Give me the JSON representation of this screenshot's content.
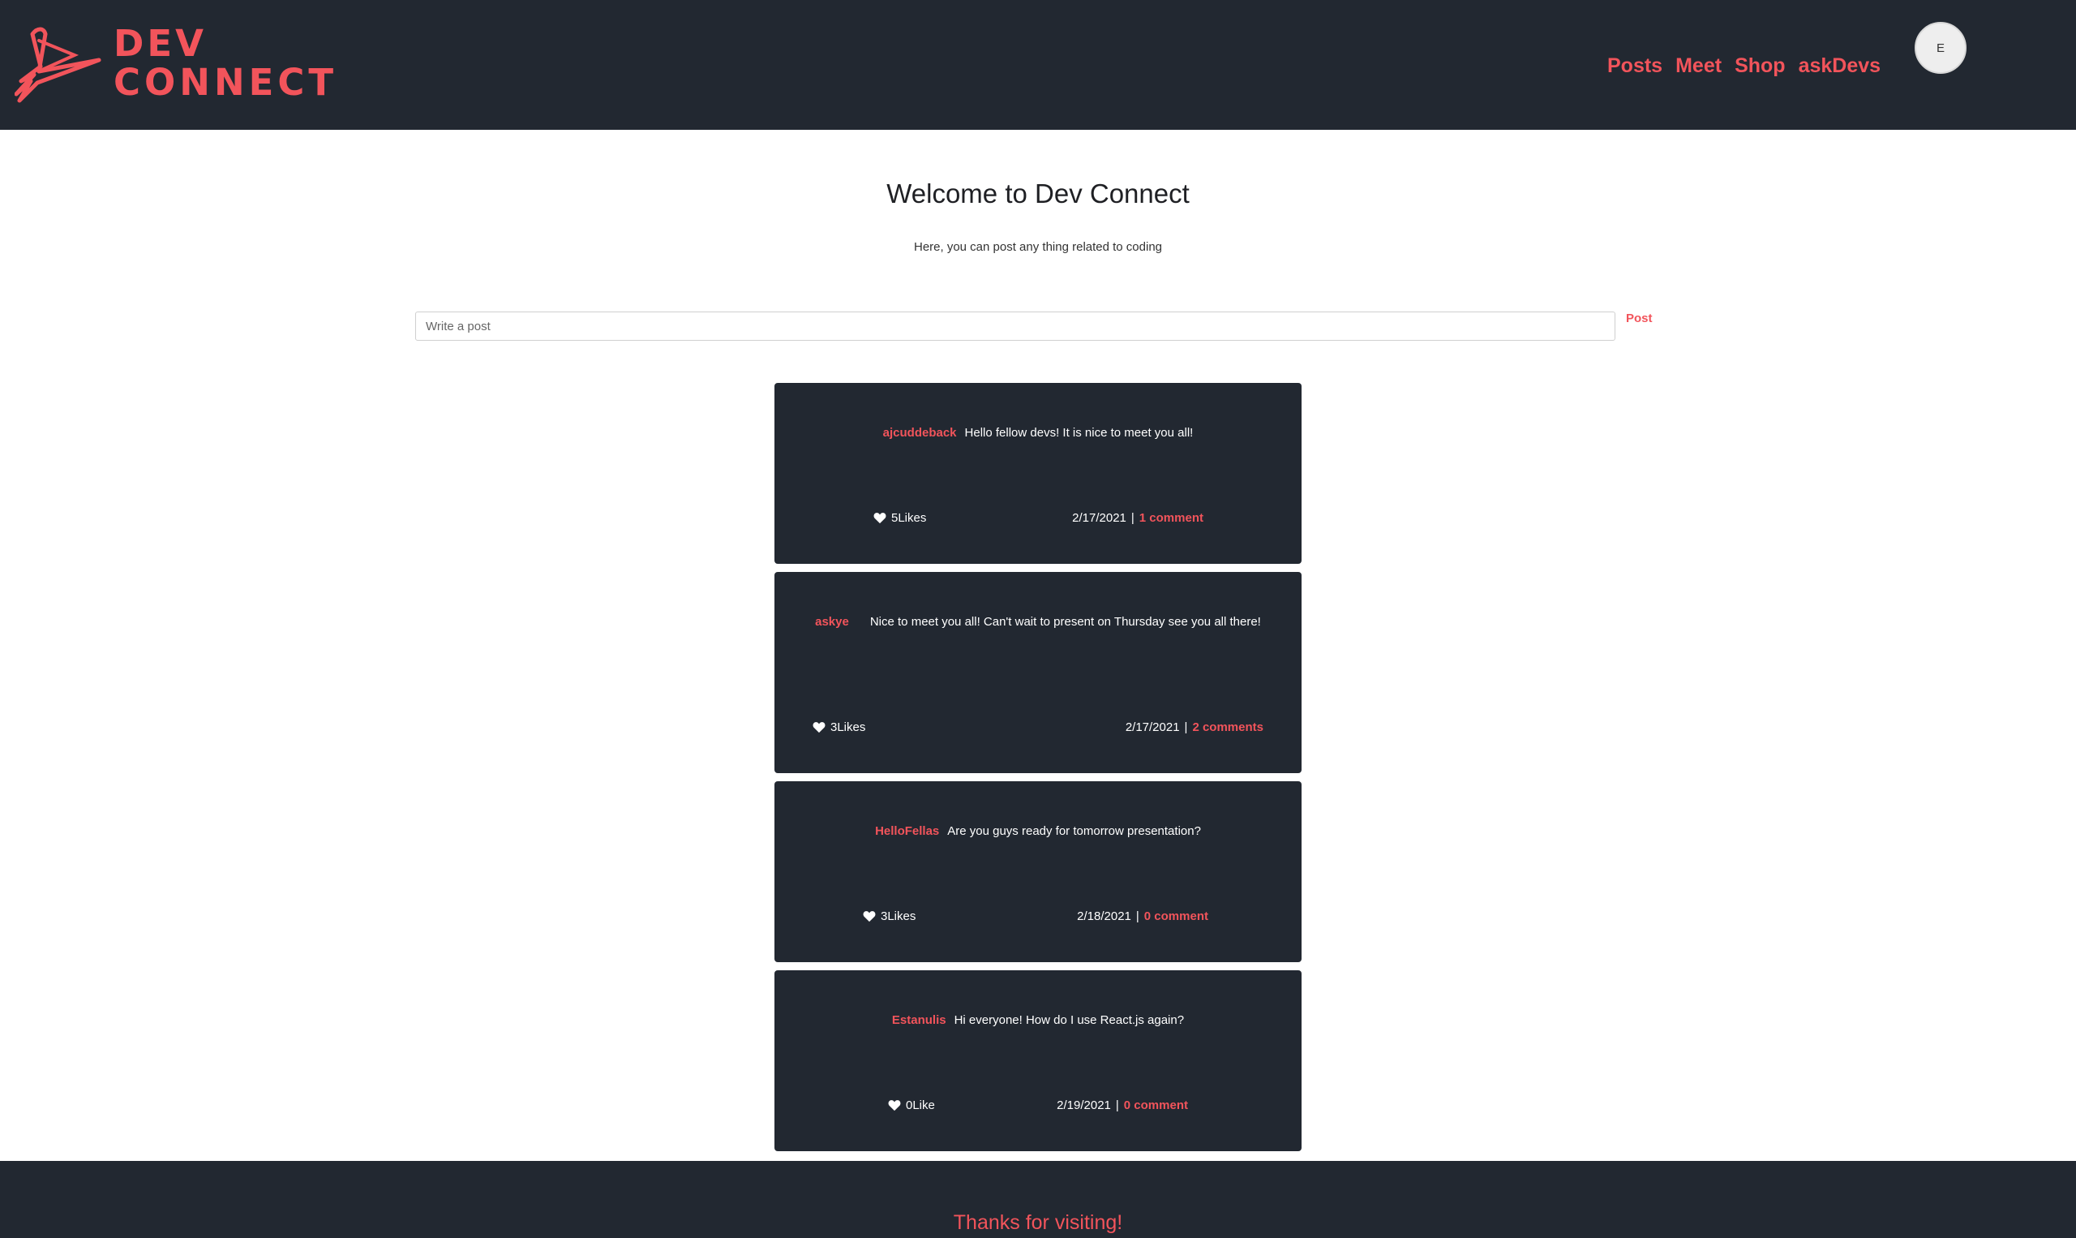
{
  "brand": {
    "line1": "DEV",
    "line2": "CONNECT",
    "accent_color": "#f2545b",
    "header_bg": "#222831"
  },
  "nav": {
    "items": [
      {
        "label": "Posts"
      },
      {
        "label": "Meet"
      },
      {
        "label": "Shop"
      },
      {
        "label": "askDevs"
      }
    ]
  },
  "user": {
    "avatar_initial": "E"
  },
  "intro": {
    "title": "Welcome to Dev Connect",
    "subtitle": "Here, you can post any thing related to coding"
  },
  "composer": {
    "placeholder": "Write a post",
    "value": "",
    "button_label": "Post"
  },
  "posts": [
    {
      "author": "ajcuddeback",
      "text": "Hello fellow devs! It is nice to meet you all!",
      "likes": "5Likes",
      "date": "2/17/2021",
      "separator": "|",
      "comments": "1 comment"
    },
    {
      "author": "askye",
      "text": "Nice to meet you all! Can't wait to present on Thursday see you all there!",
      "likes": "3Likes",
      "date": "2/17/2021",
      "separator": "|",
      "comments": "2 comments"
    },
    {
      "author": "HelloFellas",
      "text": "Are you guys ready for tomorrow presentation?",
      "likes": "3Likes",
      "date": "2/18/2021",
      "separator": "|",
      "comments": "0 comment"
    },
    {
      "author": "Estanulis",
      "text": "Hi everyone! How do I use React.js again?",
      "likes": "0Like",
      "date": "2/19/2021",
      "separator": "|",
      "comments": "0 comment"
    }
  ],
  "footer": {
    "text": "Thanks for visiting!"
  },
  "icons": {
    "logo": "scribble-logo-icon",
    "like": "heart-icon"
  }
}
